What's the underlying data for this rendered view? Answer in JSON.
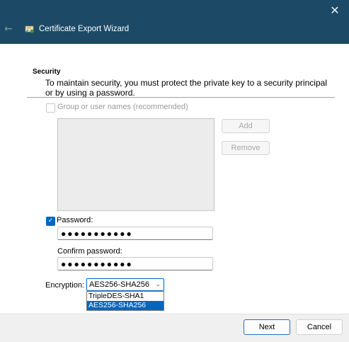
{
  "window": {
    "title": "Certificate Export Wizard",
    "close_glyph": "✕",
    "back_glyph": "←"
  },
  "security": {
    "section_title": "Security",
    "description": "To maintain security, you must protect the private key to a security principal or by using a password.",
    "group_checkbox_label": "Group or user names (recommended)",
    "group_checked": false,
    "add_label": "Add",
    "remove_label": "Remove",
    "password_checkbox_label": "Password:",
    "password_checked": true,
    "password_value": "●●●●●●●●●●●",
    "confirm_label": "Confirm password:",
    "confirm_value": "●●●●●●●●●●●",
    "encryption_label": "Encryption:",
    "encryption_selected": "AES256-SHA256",
    "encryption_options": [
      "TripleDES-SHA1",
      "AES256-SHA256"
    ]
  },
  "footer": {
    "next_label": "Next",
    "cancel_label": "Cancel"
  },
  "colors": {
    "titlebar": "#1c4a66",
    "accent": "#0067c0"
  },
  "icons": {
    "back": "back-arrow-icon",
    "wizard": "certificate-icon",
    "close": "close-icon",
    "dropdown": "chevron-down-icon",
    "check": "checkmark-icon"
  }
}
